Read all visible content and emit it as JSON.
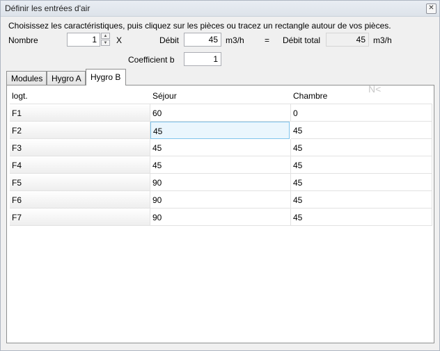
{
  "window": {
    "title": "Définir les entrées d'air",
    "close_glyph": "✕"
  },
  "form": {
    "instructions": "Choisissez les caractéristiques, puis cliquez sur les pièces ou tracez un rectangle autour de vos pièces.",
    "nombre_label": "Nombre",
    "nombre_value": "1",
    "x_label": "X",
    "debit_label": "Débit",
    "debit_value": "45",
    "debit_unit": "m3/h",
    "equals": "=",
    "debit_total_label": "Débit total",
    "debit_total_value": "45",
    "debit_total_unit": "m3/h",
    "coef_label": "Coefficient b",
    "coef_value": "1"
  },
  "tabs": [
    {
      "label": "Modules"
    },
    {
      "label": "Hygro A"
    },
    {
      "label": "Hygro B"
    }
  ],
  "active_tab": "Hygro B",
  "table": {
    "columns": [
      "logt.",
      "Séjour",
      "Chambre"
    ],
    "rows": [
      [
        "F1",
        "60",
        "0"
      ],
      [
        "F2",
        "45",
        "45"
      ],
      [
        "F3",
        "45",
        "45"
      ],
      [
        "F4",
        "45",
        "45"
      ],
      [
        "F5",
        "90",
        "45"
      ],
      [
        "F6",
        "90",
        "45"
      ],
      [
        "F7",
        "90",
        "45"
      ]
    ]
  },
  "watermark": "N<"
}
